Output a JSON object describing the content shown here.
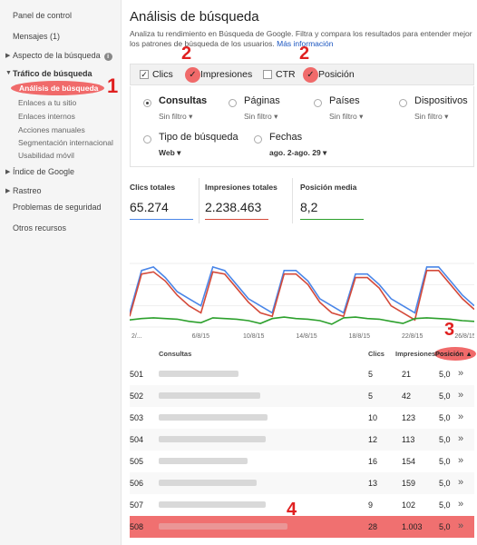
{
  "sidebar": {
    "panel": "Panel de control",
    "messages": "Mensajes (1)",
    "search_appearance": "Aspecto de la búsqueda",
    "search_traffic": "Tráfico de búsqueda",
    "search_analytics": "Análisis de búsqueda",
    "links_to_site": "Enlaces a tu sitio",
    "internal_links": "Enlaces internos",
    "manual_actions": "Acciones manuales",
    "intl_targeting": "Segmentación internacional",
    "mobile_usability": "Usabilidad móvil",
    "google_index": "Índice de Google",
    "crawl": "Rastreo",
    "security": "Problemas de seguridad",
    "other": "Otros recursos"
  },
  "annotations": {
    "n1": "1",
    "n2a": "2",
    "n2b": "2",
    "n3": "3",
    "n4": "4"
  },
  "header": {
    "title": "Análisis de búsqueda",
    "description": "Analiza tu rendimiento en Búsqueda de Google. Filtra y compara los resultados para entender mejor los patrones de búsqueda de los usuarios.",
    "more_info": "Más información"
  },
  "metrics": {
    "clicks": "Clics",
    "impressions": "Impresiones",
    "ctr": "CTR",
    "position": "Posición",
    "check": "✓"
  },
  "filters": {
    "queries": "Consultas",
    "pages": "Páginas",
    "countries": "Países",
    "devices": "Dispositivos",
    "no_filter": "Sin filtro ▾",
    "search_type": "Tipo de búsqueda",
    "search_type_val": "Web ▾",
    "dates": "Fechas",
    "dates_val": "ago. 2-ago. 29 ▾"
  },
  "totals": {
    "clicks_label": "Clics totales",
    "clicks_value": "65.274",
    "impr_label": "Impresiones totales",
    "impr_value": "2.238.463",
    "pos_label": "Posición media",
    "pos_value": "8,2"
  },
  "chart_data": {
    "type": "line",
    "x_ticks": [
      "2/...",
      "6/8/15",
      "10/8/15",
      "14/8/15",
      "18/8/15",
      "22/8/15",
      "26/8/15"
    ],
    "series": [
      {
        "name": "Clics",
        "color": "#4a86e8",
        "values": [
          2,
          8,
          8.5,
          7,
          5,
          4,
          3,
          8.5,
          8,
          6,
          4,
          3,
          2,
          8,
          8,
          6.5,
          4,
          3,
          2,
          7.5,
          7.5,
          6,
          4,
          3,
          2,
          8.5,
          8.5,
          6.5,
          4.5,
          3
        ]
      },
      {
        "name": "Impresiones",
        "color": "#d44a3a",
        "values": [
          1.5,
          7.5,
          7.8,
          6.5,
          4.5,
          3,
          2,
          7.8,
          7.5,
          5.5,
          3.5,
          2,
          1.5,
          7.5,
          7.5,
          6,
          3.5,
          2,
          1.5,
          7,
          7,
          5.5,
          3,
          2,
          1,
          8,
          8,
          6,
          4,
          2.5
        ]
      },
      {
        "name": "Posición",
        "color": "#2ca02c",
        "values": [
          1,
          1.2,
          1.3,
          1.2,
          1.1,
          0.8,
          0.6,
          1.3,
          1.2,
          1.1,
          0.9,
          0.5,
          1.2,
          1.4,
          1.2,
          1.1,
          0.9,
          0.4,
          1.3,
          1.4,
          1.2,
          1.1,
          0.8,
          0.5,
          1.2,
          1.3,
          1.2,
          1.1,
          0.9,
          0.8
        ]
      }
    ]
  },
  "table": {
    "headers": {
      "queries": "Consultas",
      "clicks": "Clics",
      "impressions": "Impresiones",
      "position": "Posición ▲"
    },
    "rows": [
      {
        "n": "501",
        "clicks": "5",
        "impr": "21",
        "pos": "5,0"
      },
      {
        "n": "502",
        "clicks": "5",
        "impr": "42",
        "pos": "5,0"
      },
      {
        "n": "503",
        "clicks": "10",
        "impr": "123",
        "pos": "5,0"
      },
      {
        "n": "504",
        "clicks": "12",
        "impr": "113",
        "pos": "5,0"
      },
      {
        "n": "505",
        "clicks": "16",
        "impr": "154",
        "pos": "5,0"
      },
      {
        "n": "506",
        "clicks": "13",
        "impr": "159",
        "pos": "5,0"
      },
      {
        "n": "507",
        "clicks": "9",
        "impr": "102",
        "pos": "5,0"
      },
      {
        "n": "508",
        "clicks": "28",
        "impr": "1.003",
        "pos": "5,0"
      }
    ],
    "more": "»"
  }
}
